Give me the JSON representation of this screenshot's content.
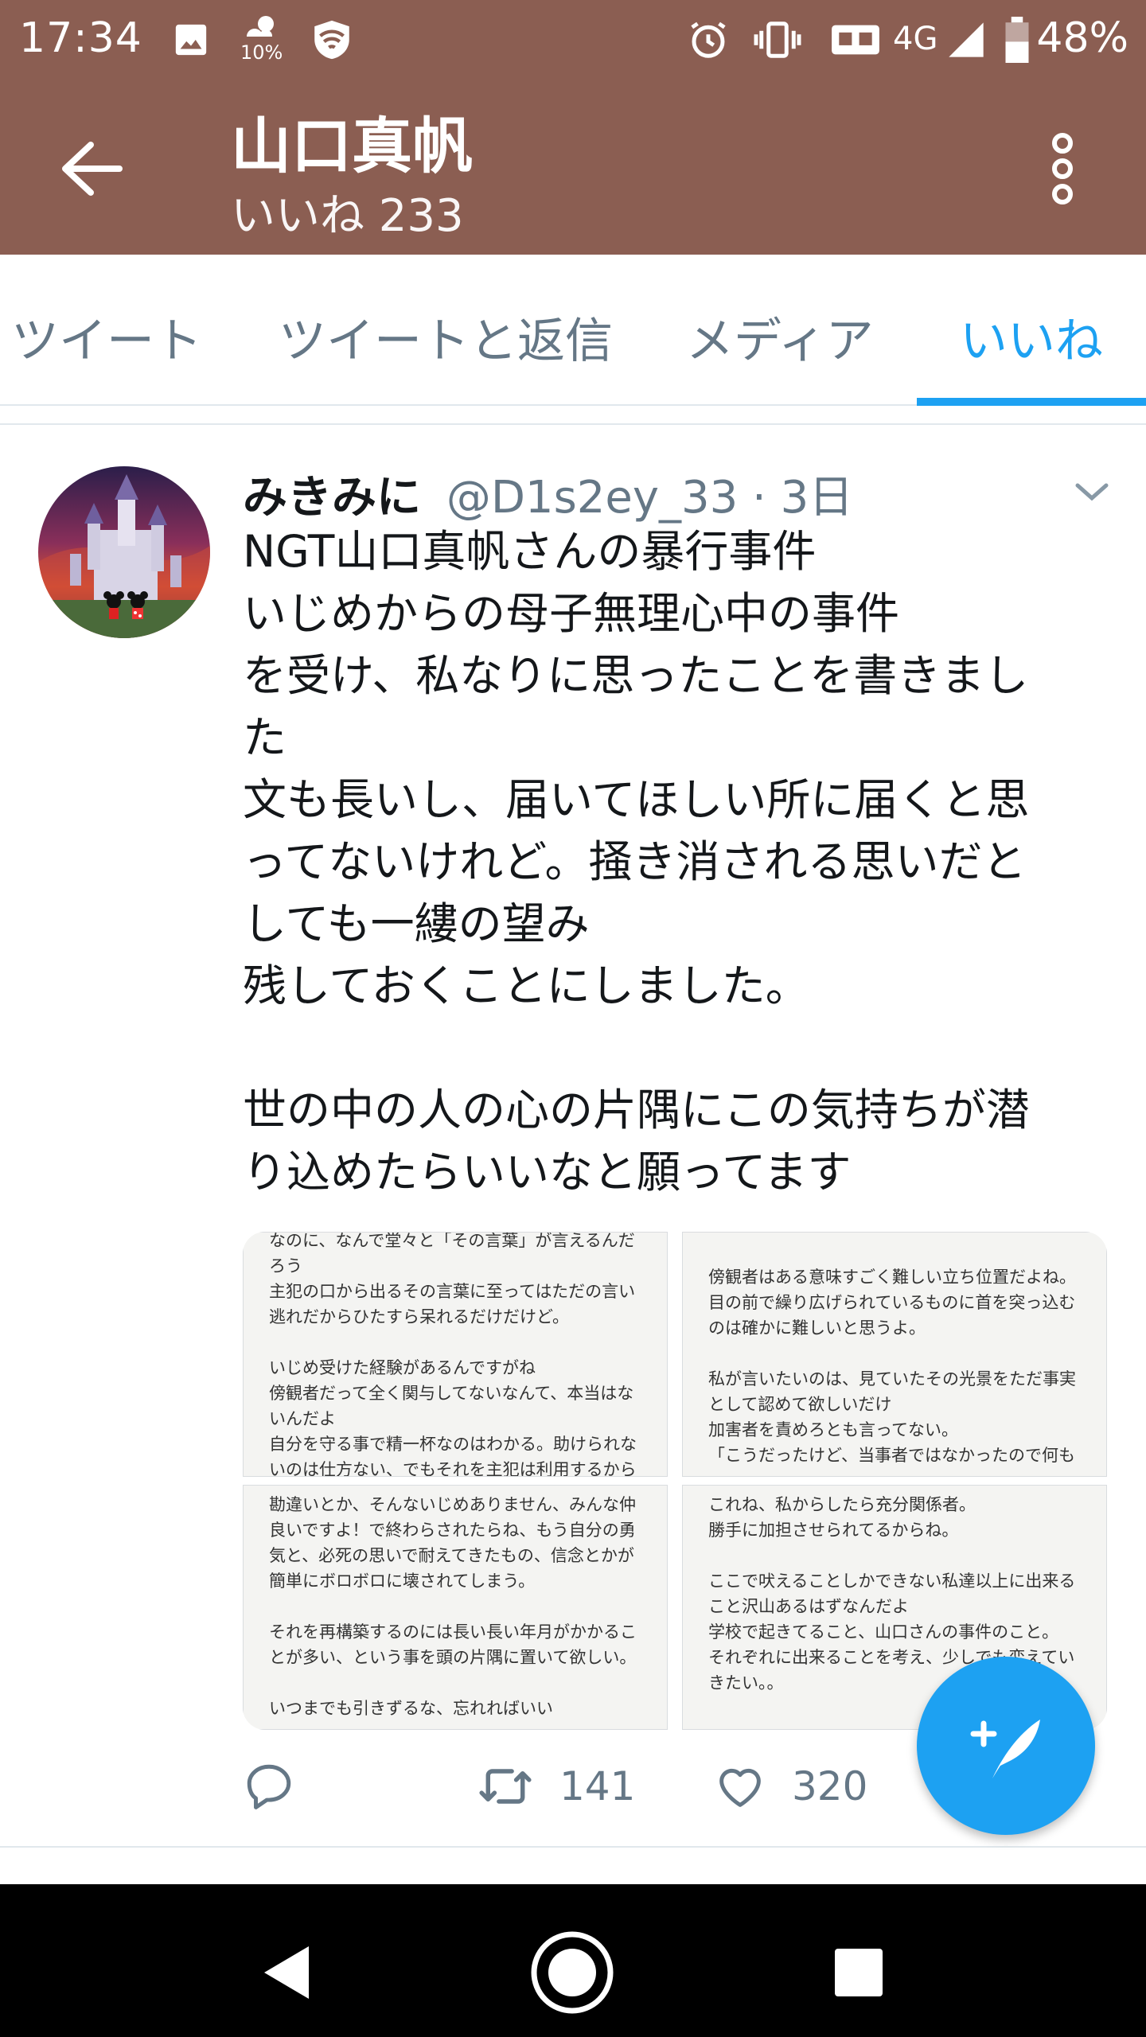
{
  "status_bar": {
    "time": "17:34",
    "weather_pct": "10%",
    "network": "4G",
    "battery": "48%",
    "icons": [
      "image-icon",
      "weather-icon",
      "vpn-shield-icon",
      "alarm-icon",
      "vibrate-icon",
      "voicemail-icon",
      "signal-icon",
      "battery-icon"
    ]
  },
  "app_bar": {
    "title": "山口真帆",
    "subtitle": "いいね 233"
  },
  "tabs": [
    {
      "label": "ツイート"
    },
    {
      "label": "ツイートと返信"
    },
    {
      "label": "メディア"
    },
    {
      "label": "いいね",
      "active": true
    }
  ],
  "tweet": {
    "name": "みきみに",
    "handle": "@D1s2ey_33",
    "time": " · 3日",
    "text_lines": [
      "NGT山口真帆さんの暴行事件",
      "いじめからの母子無理心中の事件",
      "を受け、私なりに思ったことを書きまし",
      "た",
      "文も長いし、届いてほしい所に届くと思",
      "ってないけれど。掻き消される思いだと",
      "しても一縷の望み",
      "残しておくことにしました。",
      "",
      "世の中の人の心の片隅にこの気持ちが潜",
      "り込めたらいいなと願ってます"
    ],
    "media": [
      {
        "lines": [
          "なのに、なんで堂々と「その言葉」が言えるんだ",
          "ろう",
          "主犯の口から出るその言葉に至ってはただの言い",
          "逃れだからひたすら呆れるだけだけど。",
          "",
          "いじめ受けた経験があるんですがね",
          "傍観者だって全く関与してないなんて、本当はな",
          "いんだよ",
          "自分を守る事で精一杯なのはわかる。助けられな",
          "いのは仕方ない、でもそれを主犯は利用するから"
        ]
      },
      {
        "lines": [
          "",
          "傍観者はある意味すごく難しい立ち位置だよね。",
          "目の前で繰り広げられているものに首を突っ込む",
          "のは確かに難しいと思うよ。",
          "",
          "私が言いたいのは、見ていたその光景をただ事実",
          "として認めて欲しいだけ",
          "加害者を責めろとも言ってない。",
          "「こうだったけど、当事者ではなかったので何も"
        ]
      },
      {
        "lines": [
          "勘違いとか、そんないじめありません、みんな仲",
          "良いですよ！で終わらされたらね、もう自分の勇",
          "気と、必死の思いで耐えてきたもの、信念とかが",
          "簡単にボロボロに壊されてしまう。",
          "",
          "それを再構築するのには長い長い年月がかかるこ",
          "とが多い、という事を頭の片隅に置いて欲しい。",
          "",
          "いつまでも引きずるな、忘れればいい"
        ]
      },
      {
        "lines": [
          "これね、私からしたら充分関係者。",
          "勝手に加担させられてるからね。",
          "",
          "ここで吠えることしかできない私達以上に出来る",
          "こと沢山あるはずなんだよ",
          "学校で起きてること、山口さんの事件のこと。",
          "それぞれに出来ることを考え、少しでも変えてい",
          "きたい。。"
        ]
      }
    ],
    "actions": {
      "reply_count": "",
      "retweet_count": "141",
      "like_count": "320"
    }
  },
  "colors": {
    "header": "#8b5e52",
    "accent": "#1da1f2",
    "secondary_text": "#657786"
  }
}
